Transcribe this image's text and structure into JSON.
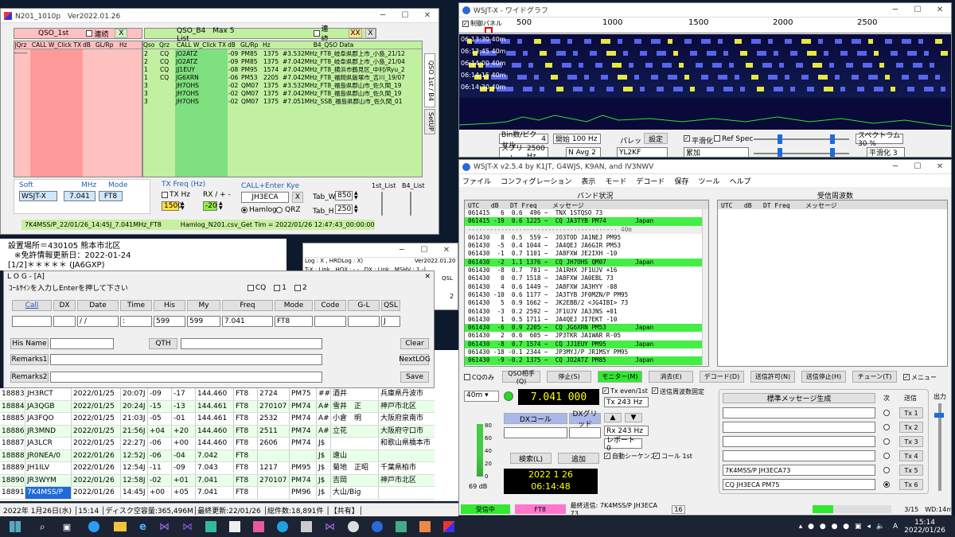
{
  "n201": {
    "title": "N201_1010p　Ver2022.01.26",
    "qso1_title": "QSO_1st",
    "renketsu1": "連続",
    "x1": "X",
    "b4_title": "QSO_B4　Max 5 List",
    "renketsu2": "連続",
    "xx": "XX",
    "x2": "X",
    "h_left": [
      "|Qrz",
      "CALL W_Click TX",
      "dB",
      "GL/Rp",
      "Hz",
      "|"
    ],
    "h_right": [
      "Qso",
      "Qrz",
      "CALL W_Click TX",
      "dB",
      "GL/Rp",
      "Hz",
      "B4_QSO Data"
    ],
    "left_dash": "------",
    "left_dash2": "--------------------------",
    "rows": [
      [
        "2",
        "CQ",
        "JO2ATZ",
        "-09",
        "PM85",
        "1375",
        "#3.532MHz_FT8_岐阜県郡上市_小島_21/12"
      ],
      [
        "2",
        "CQ",
        "JO2ATZ",
        "-09",
        "PM85",
        "1375",
        "#7.042MHz_FT8_岐阜県郡上市_小島_21/04"
      ],
      [
        "1",
        "CQ",
        "JJ1EUY",
        "-08",
        "PM95",
        "1574",
        "#7.042MHz_FT8_横浜市鶴見区_中村/Ryu_2"
      ],
      [
        "1",
        "CQ",
        "JG6XRN",
        "-06",
        "PM53",
        "2205",
        "#7.042MHz_FT8_福岡県飯塚市_吉川_19/07"
      ],
      [
        "3",
        "",
        "JH7OHS",
        "-02",
        "QM07",
        "1375",
        "#3.532MHz_FT8_福島県郡山市_佐久間_19"
      ],
      [
        "3",
        "",
        "JH7OHS",
        "-02",
        "QM07",
        "1375",
        "#7.042MHz_FT8_福島県郡山市_佐久間_19"
      ],
      [
        "3",
        "",
        "JH7OHS",
        "-02",
        "QM07",
        "1375",
        "#7.051MHz_SSB_福島県郡山市_佐久間_01"
      ]
    ],
    "side_tabs": [
      "QSO 1st / B4",
      "SetUP"
    ],
    "soft_label": "Soft",
    "soft": "WSJT-X",
    "mhz_label": "MHz",
    "mhz": "7.041",
    "mode_label": "Mode",
    "mode": "FT8",
    "txfreq_label": "TX Freq (Hz)",
    "txhz": "TX Hz",
    "rx_label": "RX / + -",
    "txfreq": "1500",
    "rx": "-20",
    "call_label": "CALL+Enter Kye",
    "call": "JH3ECA",
    "x3": "X",
    "hamlog": "Hamlog",
    "qrz": "QRZ",
    "tabw_label": "Tab_W",
    "tabw": "850",
    "tabh_label": "Tab_H",
    "tabh": "250",
    "list1_label": "1st_List",
    "list2_label": "B4_List",
    "status": "7K4MSS/P_22/01/26_14:45J_7.041MHz_FT8　　　Hamlog_N201.csv_Get Tim = 2022/01/26 12:47:43_00:00:00.2811354"
  },
  "info": {
    "line1": "設置場所＝430105 熊本市北区",
    "line2": "※免許情報更新日：2022-01-24",
    "line3": "[1/2]＊＊＊＊＊ (JA6GXP)"
  },
  "log": {
    "title": "L O G - [A]",
    "hint": "ｺｰﾙｻｲﾝを入力しEnterを押して下さい",
    "cq": "CQ",
    "o1": "1",
    "o2": "2",
    "heads": [
      "Call",
      "DX",
      "Date",
      "Time",
      "His",
      "My",
      "Freq",
      "Mode",
      "Code",
      "G-L",
      "QSL"
    ],
    "vals": [
      "",
      "",
      "  /  /",
      "   :",
      "599",
      "599",
      "7.041",
      "FT8",
      "",
      "",
      "J"
    ],
    "hisname": "His Name",
    "qth": "QTH",
    "clear": "Clear",
    "remarks1": "Remarks1",
    "nextlog": "NextLOG",
    "remarks2": "Remarks2",
    "save": "Save"
  },
  "log2": {
    "title": "Log : X , HRDLog : X)",
    "line": "T-X : Link , HQX : - - , DX : Link , MSHV : 1 -)",
    "ver": "Ver2022.01.20",
    "qsl": "QSL",
    "c2": "2"
  },
  "hamlog": {
    "rows": [
      [
        "18883",
        "JH3RCT",
        "2022/01/25",
        "20:07J",
        "-09",
        "-17",
        "144.460",
        "FT8",
        "2724",
        "PM75",
        "##",
        "酒井",
        "兵庫県丹波市"
      ],
      [
        "18884",
        "JA3QGB",
        "2022/01/25",
        "20:24J",
        "-15",
        "-13",
        "144.461",
        "FT8",
        "270107",
        "PM74",
        "A#",
        "雪井　正",
        "神戸市北区"
      ],
      [
        "18885",
        "JA3FQO",
        "2022/01/25",
        "21:03J",
        "-05",
        "-01",
        "144.461",
        "FT8",
        "2532",
        "PM74",
        "A#",
        "小倉　明",
        "大阪府泉南市"
      ],
      [
        "18886",
        "JR3MND",
        "2022/01/25",
        "21:56J",
        "+04",
        "+20",
        "144.460",
        "FT8",
        "2511",
        "PM74",
        "A#",
        "立花",
        "大阪府守口市"
      ],
      [
        "18887",
        "JA3LCR",
        "2022/01/25",
        "22:27J",
        "-06",
        "+00",
        "144.460",
        "FT8",
        "2606",
        "PM74",
        "J$",
        "",
        "和歌山県橋本市"
      ],
      [
        "18888",
        "JR0NEA/0",
        "2022/01/26",
        "12:52J",
        "-06",
        "-04",
        "7.042",
        "FT8",
        "",
        "",
        "J$",
        "遠山",
        ""
      ],
      [
        "18889",
        "JH1ILV",
        "2022/01/26",
        "12:54J",
        "-11",
        "-09",
        "7.043",
        "FT8",
        "1217",
        "PM95",
        "J$",
        "菊地　正昭",
        "千葉県柏市"
      ],
      [
        "18890",
        "JR3WYM",
        "2022/01/26",
        "12:58J",
        "-02",
        "+01",
        "7.041",
        "FT8",
        "270107",
        "PM74",
        "J$",
        "吉岡",
        "神戸市北区"
      ],
      [
        "18891",
        "7K4MSS/P",
        "2022/01/26",
        "14:45J",
        "+00",
        "+05",
        "7.041",
        "FT8",
        "",
        "PM96",
        "J$",
        "大山/Big",
        ""
      ]
    ],
    "side": [
      "市",
      "市",
      "市",
      "市",
      "市",
      "市"
    ],
    "status": "2022年 1月26日(水) │15:14 │ディスク空容量:365,496M│最終更新:22/01/26 │総件数:18,891件 │【共有】│"
  },
  "wide": {
    "title": "WSJT-X - ワイドグラフ",
    "ctl": "制御パネル",
    "ticks": [
      "500",
      "1000",
      "1500",
      "2000",
      "2500"
    ],
    "times": [
      "06:14:30  40m",
      "06:14:15  40m",
      "06:14:00  40m",
      "06:13:45  40m",
      "06:13:30  40m"
    ],
    "bins_label": "Bin数/ピクセル",
    "bins": "4",
    "start_label": "開始",
    "start": "100 Hz",
    "palette_label": "パレット",
    "setting": "設定",
    "flatten": "平滑化",
    "refspec": "Ref Spec",
    "spectrum": "スペクトラム 30 %",
    "split_label": "スプリット",
    "split": "2500 Hz",
    "navg_label": "N Avg",
    "navg": "2",
    "palette": "YL2KF",
    "mode2": "累加",
    "smooth": "平滑化 3"
  },
  "wsjt": {
    "title": "WSJT-X   v2.5.4   by K1JT, G4WJS, K9AN, and IV3NWV",
    "menu": [
      "ファイル",
      "コンフィグレーション",
      "表示",
      "モード",
      "デコード",
      "保存",
      "ツール",
      "ヘルプ"
    ],
    "band_title": "バンド状況",
    "rx_title": "受信周波数",
    "head": "UTC   dB   DT Freq    メッセージ",
    "rows": [
      {
        "t": "061415   6  0.6  496 ~  TNX 1STQSO 73",
        "g": false
      },
      {
        "t": "061415 -19  0.6 1225 ~  CQ JA3TYB PM74        Japan",
        "g": true
      },
      {
        "t": "----------------------------------------- 40m",
        "g": false,
        "sep": true
      },
      {
        "t": "061430   8  0.5  559 ~  JO3TOD JA1NEJ PM95",
        "g": false
      },
      {
        "t": "061430  -5  0.4 1044 ~  JA4QEJ JA6GIR PM53",
        "g": false
      },
      {
        "t": "061430  -1  0.7 1101 ~  JA8FXW JE2IXH -10",
        "g": false
      },
      {
        "t": "061430  -2  1.1 1376 ~  CQ JH7OHS QM07        Japan",
        "g": true
      },
      {
        "t": "061430  -8  0.7  781 ~  JA1RHX JF1UJV +16",
        "g": false
      },
      {
        "t": "061430   0  0.7 1518 ~  JA8FXW JA0EBL 73",
        "g": false
      },
      {
        "t": "061430   4  0.6 1449 ~  JA8FXW JA3HYY -08",
        "g": false
      },
      {
        "t": "061430 -10  0.6 1177 ~  JA3TYB JF0MZN/P PM95",
        "g": false
      },
      {
        "t": "061430   5  0.9 1662 ~  JK2EBB/2 <JG4IBI> 73",
        "g": false
      },
      {
        "t": "061430  -3  0.2 2592 ~  JF1UJV JA3JNS +01",
        "g": false
      },
      {
        "t": "061430   1  0.5 1711 ~  JA4QEJ JI7EKT -10",
        "g": false
      },
      {
        "t": "061430  -6  0.9 2205 ~  CQ JG6XRN PM53        Japan",
        "g": true
      },
      {
        "t": "061430   2  0.6  605 ~  JP3TKR JA1WAR R-05",
        "g": false
      },
      {
        "t": "061430  -8  0.7 1574 ~  CQ JJ1EUY PM95        Japan",
        "g": true
      },
      {
        "t": "061430 -18 -0.1 2344 ~  JP3MYJ/P JR1MSY PM95",
        "g": false
      },
      {
        "t": "061430  -9 -0.2 1375 ~  CQ JO2ATZ PM85        Japan",
        "g": true
      }
    ],
    "buttons": [
      "CQのみ",
      "QSO相手(Q)",
      "停止(S)",
      "モニター(M)",
      "消去(E)",
      "デコード(D)",
      "送信許可(N)",
      "送信停止(H)",
      "チューン(T)",
      "メニュー"
    ],
    "band": "40m",
    "freq": "7.041 000",
    "tx_even": "Tx even/1st",
    "hold": "送信周波数固定",
    "dxcall_label": "DXコール",
    "dxgrid_label": "DXグリッド",
    "txhz": "Tx 243 Hz",
    "rxhz": "Rx 243 Hz",
    "report": "レポート 0",
    "search": "検索(L)",
    "add": "追加",
    "auto": "自動シーケンス",
    "call1st": "コール 1st",
    "date": "2022 1 26",
    "time": "06:14:48",
    "meter": [
      "80",
      "60",
      "40",
      "20",
      "0"
    ],
    "db": "69 dB",
    "std_title": "標準メッセージ生成",
    "next_label": "次",
    "send_label": "送信",
    "power_label": "出力",
    "tx_msgs": [
      "",
      "",
      "",
      "",
      "7K4MSS/P JH3ECA73",
      "CQ JH3ECA PM75"
    ],
    "tx_btns": [
      "Tx 1",
      "Tx 2",
      "Tx 3",
      "Tx 4",
      "Tx 5",
      "Tx 6"
    ],
    "status_recv": "受信中",
    "status_mode": "FT8",
    "status_last": "最終送信: 7K4MSS/P JH3ECA 73",
    "status_num": "16",
    "status_page": "3/15",
    "status_wd": "WD:14m"
  },
  "taskbar": {
    "time": "15:14",
    "date": "2022/01/26",
    "lang": "A"
  },
  "colors": {
    "pink": "#ffc0c0",
    "green": "#c0f0a0",
    "lime": "#44ee44",
    "accent": "#ff77cc"
  }
}
